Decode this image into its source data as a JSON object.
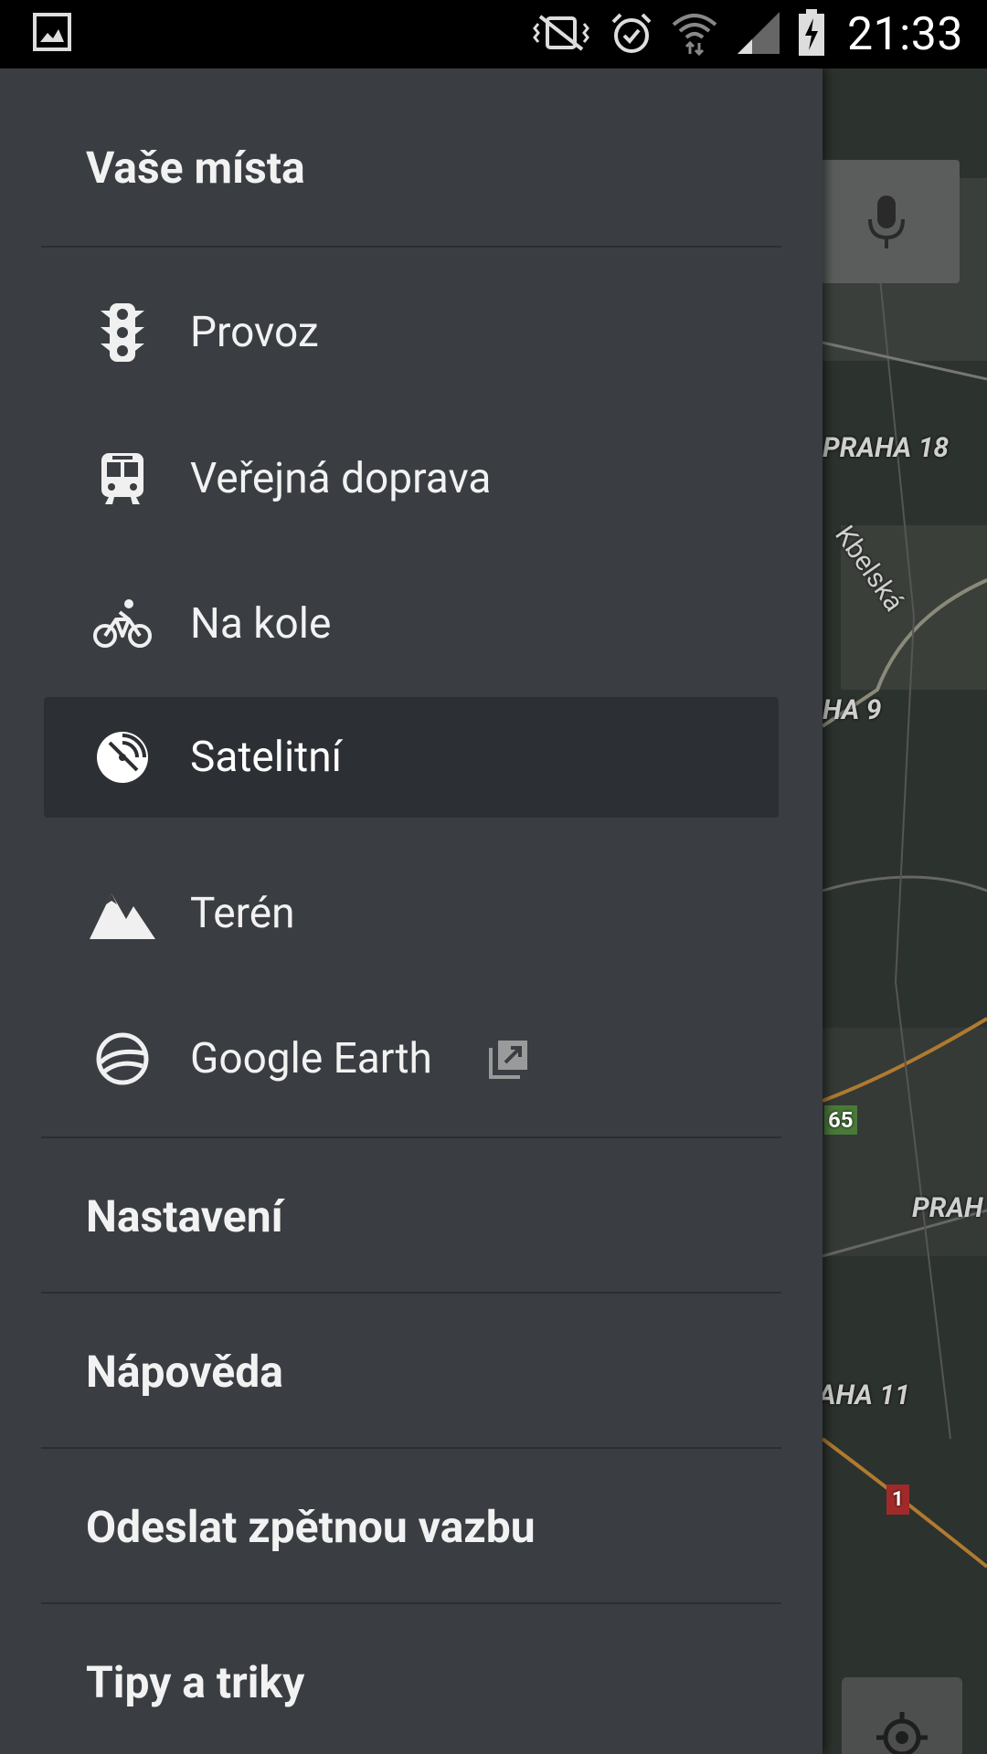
{
  "status_bar": {
    "time": "21:33",
    "icons": [
      "gallery-icon",
      "vibrate-icon",
      "alarm-icon",
      "wifi-icon",
      "signal-icon",
      "battery-charging-icon"
    ]
  },
  "drawer": {
    "header_title": "Vaše místa",
    "layers": [
      {
        "label": "Provoz",
        "icon": "traffic-light-icon"
      },
      {
        "label": "Veřejná doprava",
        "icon": "transit-icon"
      },
      {
        "label": "Na kole",
        "icon": "bicycle-icon"
      },
      {
        "label": "Satelitní",
        "icon": "satellite-icon",
        "selected": true
      },
      {
        "label": "Terén",
        "icon": "terrain-icon"
      },
      {
        "label": "Google Earth",
        "icon": "earth-icon",
        "external": true
      }
    ],
    "footer_items": [
      {
        "label": "Nastavení"
      },
      {
        "label": "Nápověda"
      },
      {
        "label": "Odeslat zpětnou vazbu"
      },
      {
        "label": "Tipy a triky"
      }
    ]
  },
  "map": {
    "labels": [
      "PRAHA 18",
      "Kbelská",
      "HA 9",
      "65",
      "PRAH",
      "AHA 11",
      "1"
    ]
  },
  "colors": {
    "drawer_bg": "#3a3e42",
    "selected_bg": "#2c2f33",
    "text": "#f2f2f2"
  }
}
